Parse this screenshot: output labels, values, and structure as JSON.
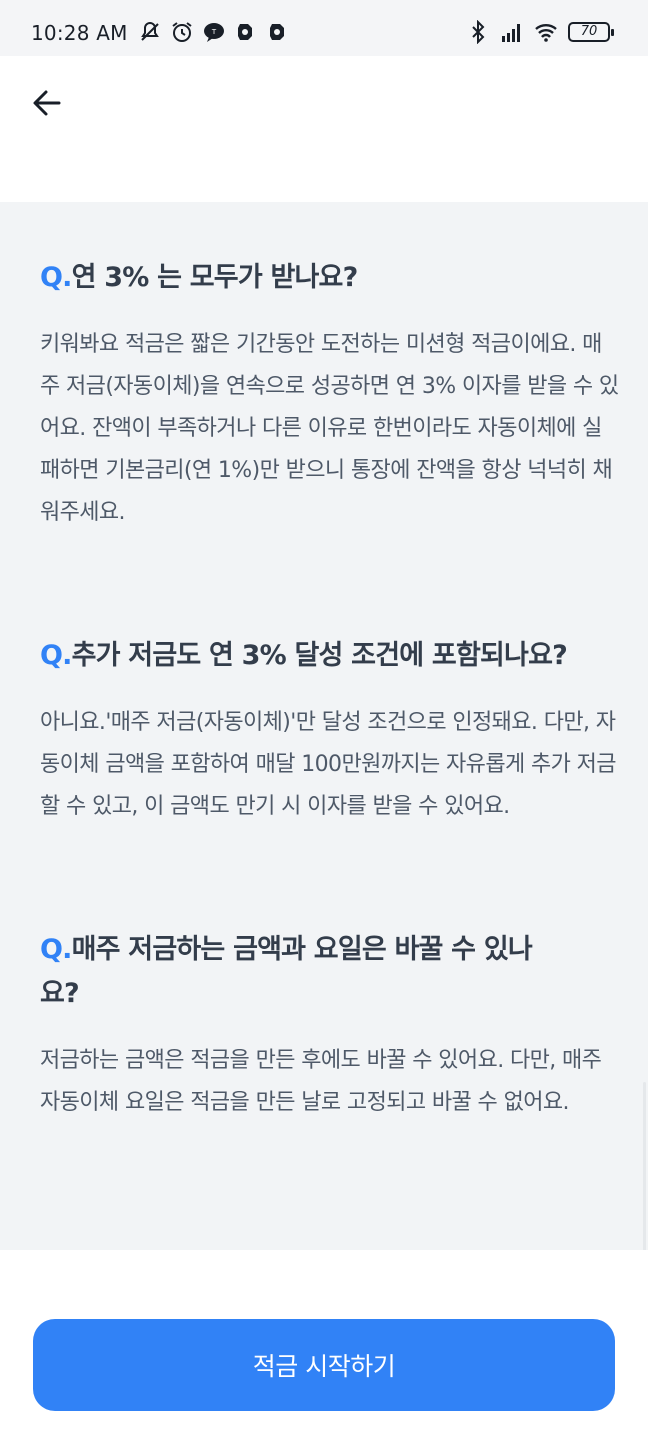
{
  "status_bar": {
    "time": "10:28 AM",
    "left_icons": [
      "mute-icon",
      "alarm-icon",
      "talk-icon",
      "app-icon",
      "app-icon"
    ],
    "right_icons": [
      "bluetooth-icon",
      "signal-icon",
      "wifi-icon"
    ],
    "battery": "70"
  },
  "header": {
    "back_icon": "arrow-left-icon"
  },
  "faq": [
    {
      "q_prefix": "Q.",
      "question": "연 3% 는 모두가 받나요?",
      "answer": "키워봐요 적금은 짧은 기간동안 도전하는 미션형 적금이에요. 매주 저금(자동이체)을 연속으로 성공하면 연 3% 이자를 받을 수 있어요. 잔액이 부족하거나 다른 이유로 한번이라도 자동이체에 실패하면 기본금리(연 1%)만 받으니 통장에 잔액을 항상 넉넉히 채워주세요."
    },
    {
      "q_prefix": "Q.",
      "question": "추가 저금도 연 3% 달성 조건에 포함되나요?",
      "answer": "아니요.'매주 저금(자동이체)'만 달성 조건으로 인정돼요. 다만, 자동이체 금액을 포함하여 매달 100만원까지는 자유롭게 추가 저금 할 수 있고, 이 금액도 만기 시 이자를 받을 수 있어요."
    },
    {
      "q_prefix": "Q.",
      "question": "매주 저금하는 금액과 요일은 바꿀 수 있나요?",
      "answer": "저금하는 금액은 적금을 만든 후에도 바꿀 수 있어요. 다만, 매주 자동이체 요일은 적금을 만든 날로 고정되고 바꿀 수 없어요."
    }
  ],
  "cta": {
    "label": "적금 시작하기"
  },
  "colors": {
    "accent": "#3182f6",
    "faq_background": "#f2f4f6",
    "text": "#333d4b"
  }
}
